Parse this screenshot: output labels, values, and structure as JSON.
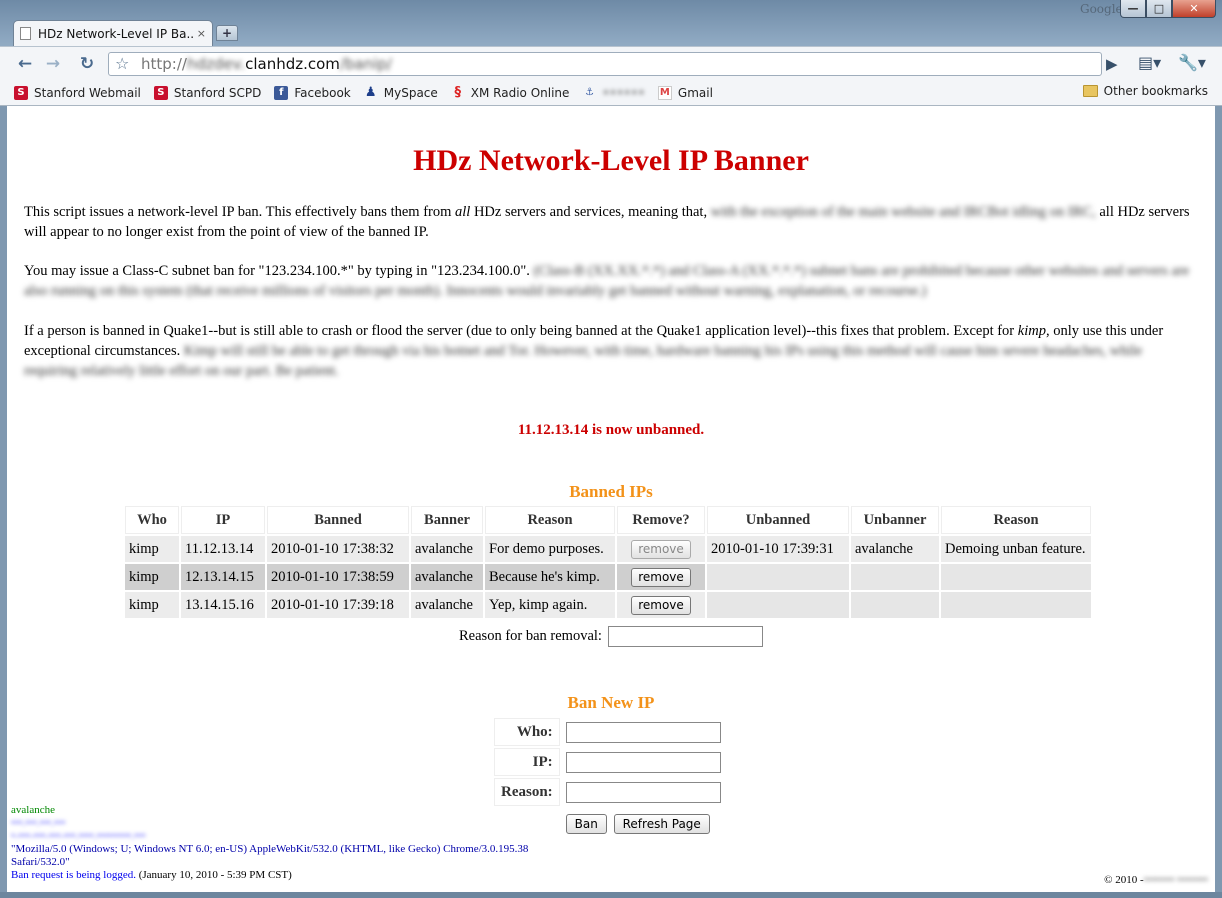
{
  "window": {
    "search_brand": "Google",
    "minimize": "—",
    "maximize": "□",
    "close": "✕"
  },
  "tab": {
    "title": "HDz Network-Level IP Ba...",
    "close": "×",
    "new_tab": "+"
  },
  "toolbar": {
    "back": "←",
    "forward": "→",
    "reload": "↻",
    "star": "☆",
    "url_scheme": "http://",
    "url_subdomain": "hdzdev.",
    "url_host": "clanhdz.com",
    "url_path": "/banip/",
    "go": "▶",
    "page_menu": "▤▾",
    "tools_menu": "🔧▾"
  },
  "bookmarks": [
    {
      "icon": "stanford-icon",
      "glyph": "S",
      "label": "Stanford Webmail"
    },
    {
      "icon": "stanford-icon",
      "glyph": "S",
      "label": "Stanford SCPD"
    },
    {
      "icon": "facebook-icon",
      "glyph": "f",
      "label": "Facebook"
    },
    {
      "icon": "myspace-icon",
      "glyph": "♟",
      "label": "MySpace"
    },
    {
      "icon": "xm-radio-icon",
      "glyph": "§",
      "label": "XM Radio Online"
    },
    {
      "icon": "bookmark-icon",
      "glyph": "⚓",
      "label": "••••••"
    },
    {
      "icon": "gmail-icon",
      "glyph": "M",
      "label": "Gmail"
    }
  ],
  "other_bookmarks": "Other bookmarks",
  "page": {
    "title": "HDz Network-Level IP Banner",
    "p1_a": "This script issues a network-level IP ban. This effectively bans them from ",
    "p1_em": "all",
    "p1_b": " HDz servers and services, meaning that,",
    "p1_blur": " with the exception of the main website and IRCBot idling on IRC,",
    "p1_c": " all HDz servers will appear to no longer exist from the point of view of the banned IP.",
    "p2_a": "You may issue a Class-C subnet ban for \"123.234.100.*\" by typing in \"123.234.100.0\".",
    "p2_blur": " (Class-B (XX.XX.*.*) and Class-A (XX.*.*.*) subnet bans are prohibited because other websites and servers are also running on this system (that receive millions of visitors per month). Innocents would invariably get banned without warning, explanation, or recourse.)",
    "p3_a": "If a person is banned in Quake1--but is still able to crash or flood the server (due to only being banned at the Quake1 application level)--this fixes that problem. Except for ",
    "p3_em": "kimp",
    "p3_b": ", only use this under exceptional circumstances.",
    "p3_blur": " Kimp will still be able to get through via his botnet and Tor. However, with time, hardware banning his IPs using this method will cause him severe headaches, while requiring relatively little effort on our part. Be patient.",
    "status": "11.12.13.14 is now unbanned."
  },
  "banned": {
    "heading": "Banned IPs",
    "columns": [
      "Who",
      "IP",
      "Banned",
      "Banner",
      "Reason",
      "Remove?",
      "Unbanned",
      "Unbanner",
      "Reason"
    ],
    "rows": [
      {
        "who": "kimp",
        "ip": "11.12.13.14",
        "banned": "2010-01-10 17:38:32",
        "banner": "avalanche",
        "reason": "For demo purposes.",
        "remove": "remove",
        "unbanned": "2010-01-10 17:39:31",
        "unbanner": "avalanche",
        "unban_reason": "Demoing unban feature."
      },
      {
        "who": "kimp",
        "ip": "12.13.14.15",
        "banned": "2010-01-10 17:38:59",
        "banner": "avalanche",
        "reason": "Because he's kimp.",
        "remove": "remove",
        "unbanned": "",
        "unbanner": "",
        "unban_reason": ""
      },
      {
        "who": "kimp",
        "ip": "13.14.15.16",
        "banned": "2010-01-10 17:39:18",
        "banner": "avalanche",
        "reason": "Yep, kimp again.",
        "remove": "remove",
        "unbanned": "",
        "unbanner": "",
        "unban_reason": ""
      }
    ],
    "removal_label": "Reason for ban removal:"
  },
  "new_ban": {
    "heading": "Ban New IP",
    "who_label": "Who:",
    "ip_label": "IP:",
    "reason_label": "Reason:",
    "ban_button": "Ban",
    "refresh_button": "Refresh Page"
  },
  "footer": {
    "user": "avalanche",
    "ip_blur": "•••.•••.•••.•••",
    "host_blur": "•-•••-•••-•••-•••.••••.•••••••••.•••",
    "user_agent": "\"Mozilla/5.0 (Windows; U; Windows NT 6.0; en-US) AppleWebKit/532.0 (KHTML, like Gecko) Chrome/3.0.195.38 Safari/532.0\"",
    "log_link": "Ban request is being logged.",
    "log_time": " (January 10, 2010 - 5:39 PM CST)",
    "copyright": "© 2010 - ",
    "copyright_blur": "•••••••• ••••••••"
  }
}
